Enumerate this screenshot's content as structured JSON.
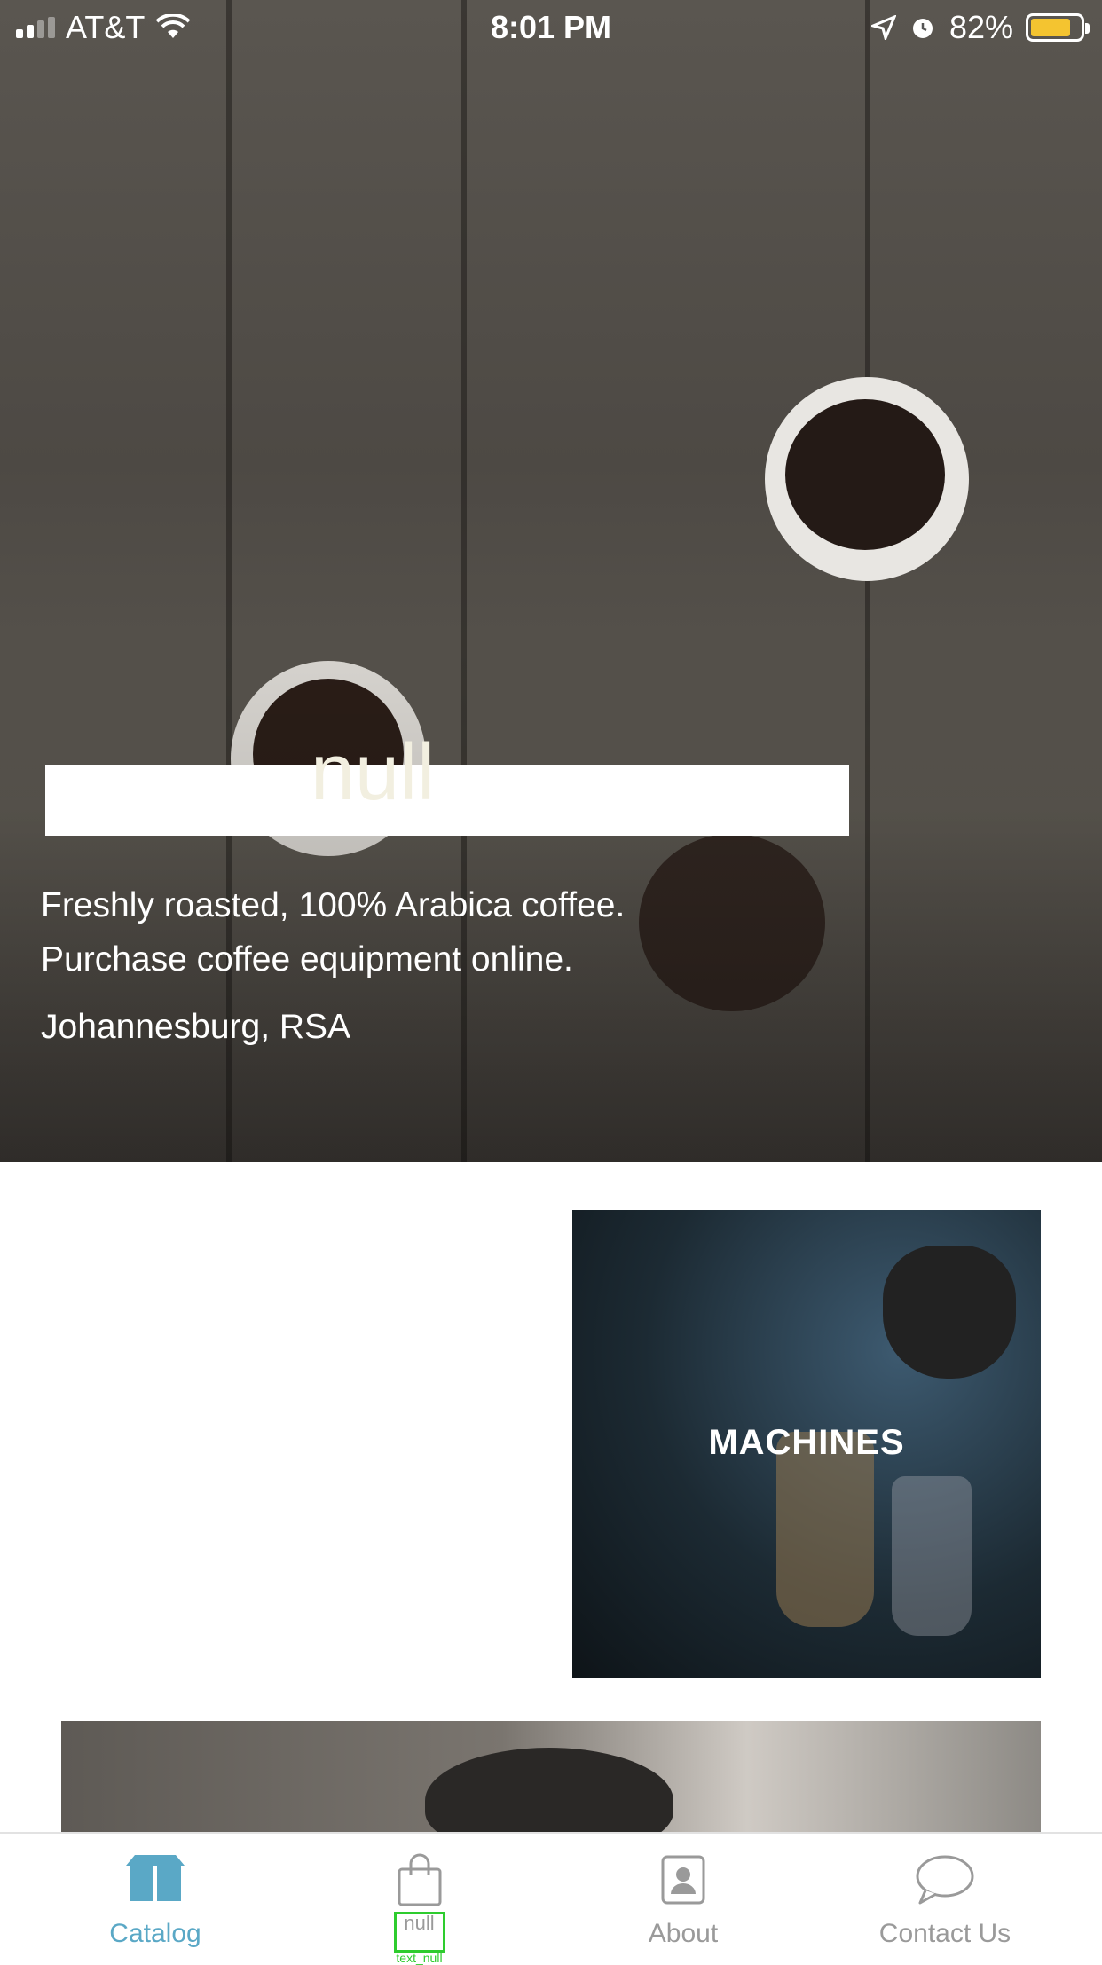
{
  "status_bar": {
    "carrier": "AT&T",
    "time": "8:01 PM",
    "battery": "82%",
    "battery_level": 0.82
  },
  "hero": {
    "title": "null",
    "tagline_line1": "Freshly roasted, 100% Arabica coffee.",
    "tagline_line2": "Purchase coffee equipment online.",
    "location": "Johannesburg, RSA"
  },
  "categories": [
    {
      "label": "MACHINES"
    }
  ],
  "tab_bar": {
    "items": [
      {
        "label": "Catalog",
        "icon": "box-icon",
        "active": true
      },
      {
        "label": "null",
        "icon": "shopping-bag-icon",
        "active": false,
        "sub": "text_null"
      },
      {
        "label": "About",
        "icon": "contact-card-icon",
        "active": false
      },
      {
        "label": "Contact Us",
        "icon": "chat-bubble-icon",
        "active": false
      }
    ]
  },
  "colors": {
    "accent": "#5aa8c6",
    "tab_inactive": "#9a9a9a",
    "battery": "#f4c430"
  }
}
